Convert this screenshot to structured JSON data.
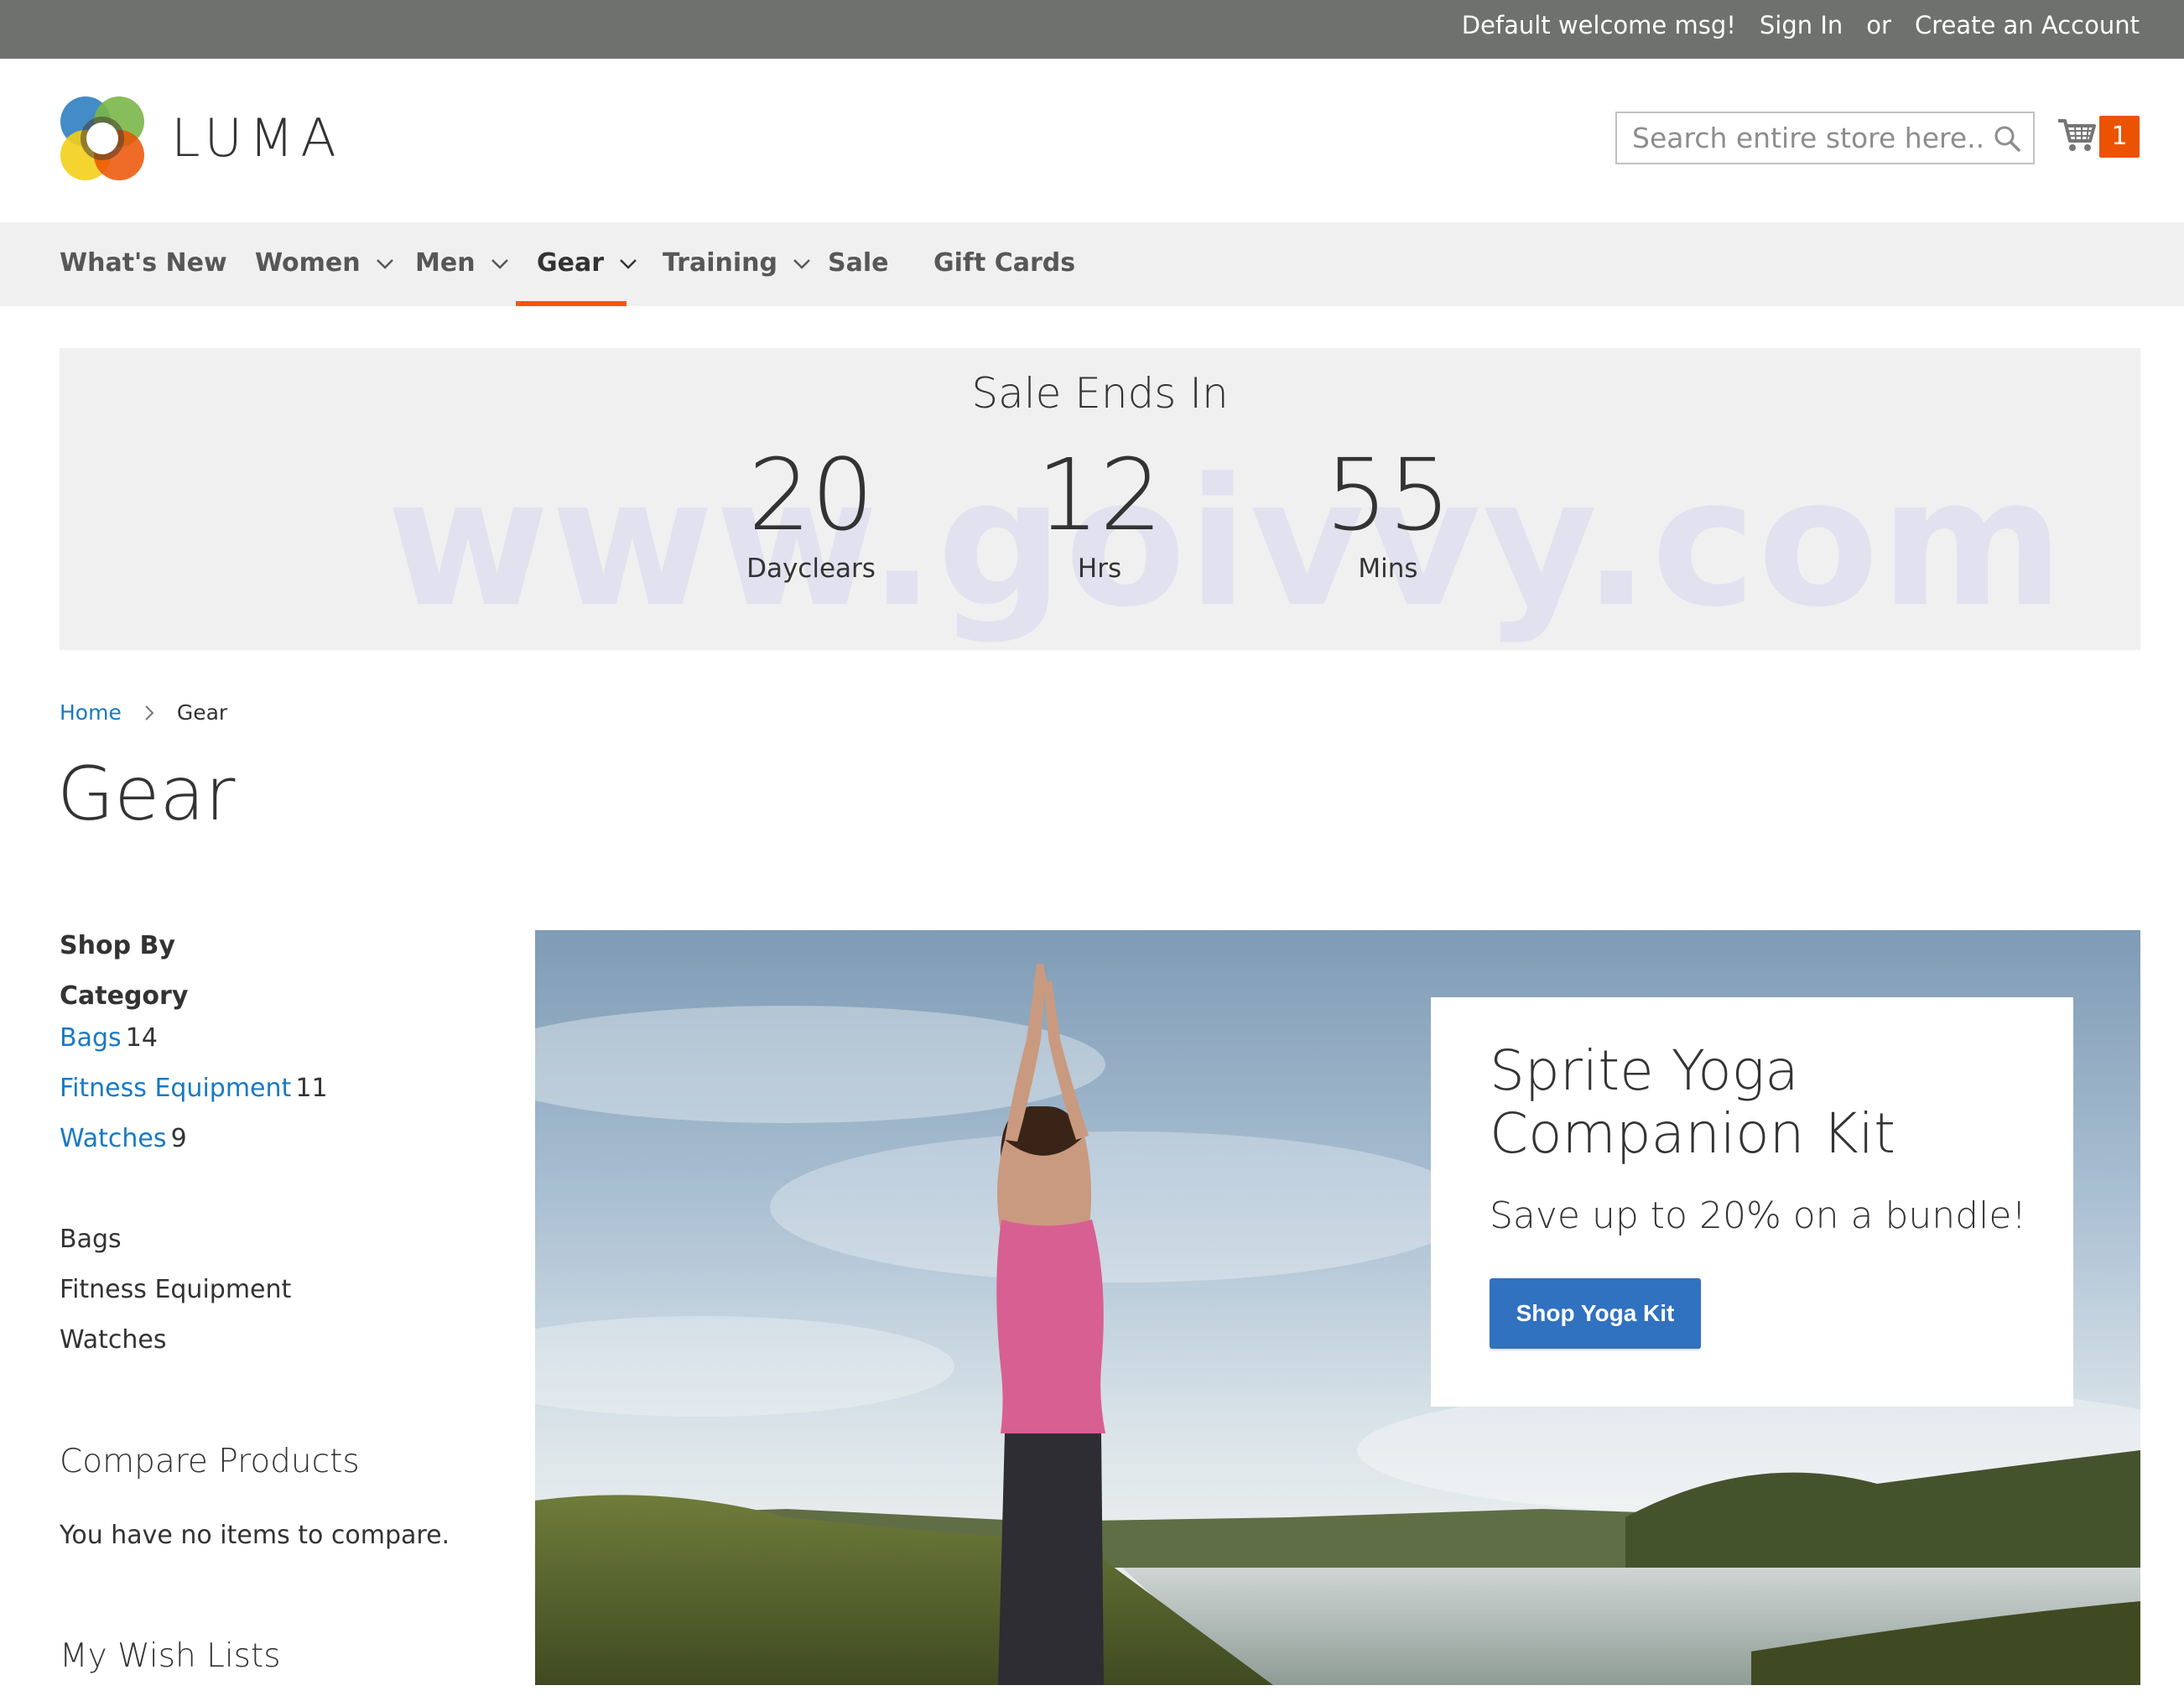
{
  "topbar": {
    "welcome": "Default welcome msg!",
    "sign_in": "Sign In",
    "or": "or",
    "create_account": "Create an Account"
  },
  "header": {
    "brand": "LUMA",
    "search_placeholder": "Search entire store here...",
    "cart_count": "1"
  },
  "nav": {
    "items": [
      {
        "label": "What's New",
        "dropdown": false
      },
      {
        "label": "Women",
        "dropdown": true
      },
      {
        "label": "Men",
        "dropdown": true
      },
      {
        "label": "Gear",
        "dropdown": true,
        "active": true
      },
      {
        "label": "Training",
        "dropdown": true
      },
      {
        "label": "Sale",
        "dropdown": false
      },
      {
        "label": "Gift Cards",
        "dropdown": false
      }
    ]
  },
  "countdown": {
    "title": "Sale Ends In",
    "blocks": [
      {
        "value": "20",
        "label": "Dayclears"
      },
      {
        "value": "12",
        "label": "Hrs"
      },
      {
        "value": "55",
        "label": "Mins"
      }
    ],
    "watermark": "www.goivvy.com"
  },
  "breadcrumb": {
    "home": "Home",
    "current": "Gear"
  },
  "page_title": "Gear",
  "sidebar": {
    "shop_by": "Shop By",
    "category_heading": "Category",
    "categories": [
      {
        "label": "Bags",
        "count": "14"
      },
      {
        "label": "Fitness Equipment",
        "count": "11"
      },
      {
        "label": "Watches",
        "count": "9"
      }
    ],
    "plain_links": [
      "Bags",
      "Fitness Equipment",
      "Watches"
    ],
    "compare_title": "Compare Products",
    "compare_text": "You have no items to compare.",
    "wishlist_title": "My Wish Lists"
  },
  "hero": {
    "promo_title": "Sprite Yoga Companion Kit",
    "promo_subtitle": "Save up to 20% on a bundle!",
    "button_label": "Shop Yoga Kit"
  },
  "colors": {
    "topbar": "#6e716e",
    "accent": "#eb5202",
    "link": "#1979c3",
    "button": "#3071c0"
  }
}
